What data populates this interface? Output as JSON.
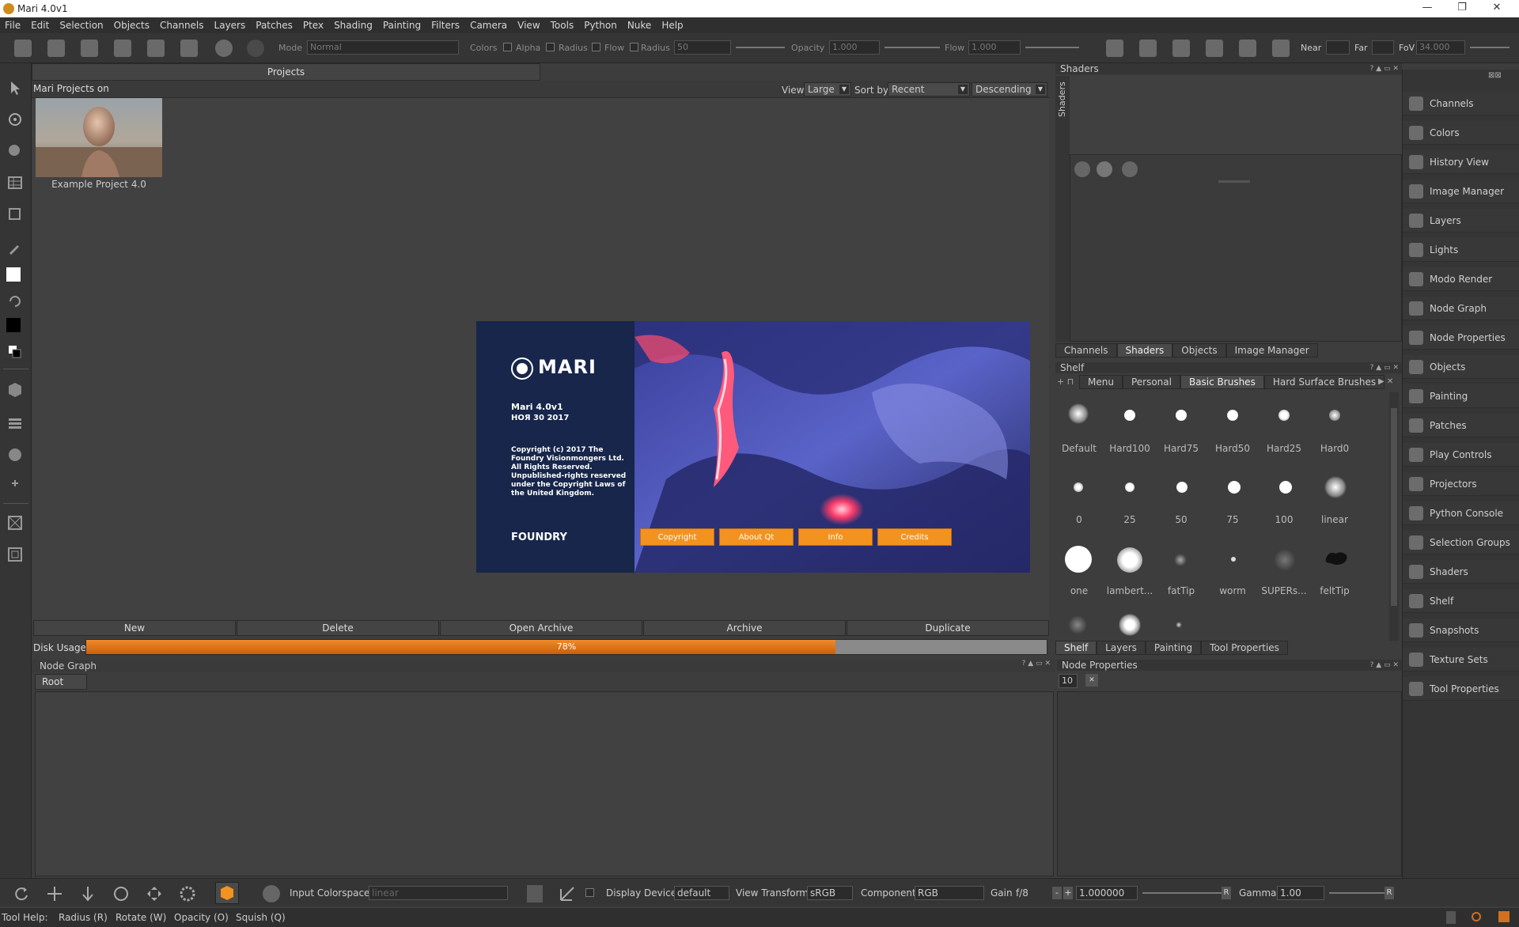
{
  "window": {
    "title": "Mari 4.0v1",
    "minimize": "—",
    "maximize": "❐",
    "close": "✕"
  },
  "menu": [
    "File",
    "Edit",
    "Selection",
    "Objects",
    "Channels",
    "Layers",
    "Patches",
    "Ptex",
    "Shading",
    "Painting",
    "Filters",
    "Camera",
    "View",
    "Tools",
    "Python",
    "Nuke",
    "Help"
  ],
  "toolbar": {
    "mode_label": "Mode",
    "mode_value": "Normal",
    "colors_label": "Colors",
    "alpha_label": "Alpha",
    "radius_label": "Radius",
    "flow_label": "Flow",
    "radius2_label": "Radius",
    "radius_value": "50",
    "opacity_label": "Opacity",
    "opacity_value": "1.000",
    "flow2_label": "Flow",
    "flow_value": "1.000",
    "near_label": "Near",
    "far_label": "Far",
    "fov_label": "FoV",
    "fov_value": "34.000"
  },
  "projects": {
    "tab": "Projects",
    "header": "Mari Projects on",
    "view_label": "View",
    "view_value": "Large",
    "sort_label": "Sort by",
    "sort_value": "Recent",
    "order_value": "Descending",
    "items": [
      {
        "name": "Example Project 4.0"
      }
    ],
    "buttons": [
      "New",
      "Delete",
      "Open Archive",
      "Archive",
      "Duplicate"
    ],
    "disk_label": "Disk Usage",
    "disk_percent_text": "78%",
    "disk_fraction": 0.78
  },
  "splash": {
    "logo": "MARI",
    "version": "Mari 4.0v1",
    "date": "НОЯ 30 2017",
    "copyright": "Copyright (c) 2017 The Foundry Visionmongers Ltd.  All Rights Reserved.  Unpublished-rights reserved under the Copyright Laws of the United Kingdom.",
    "company": "FOUNDRY",
    "buttons": [
      "Copyright",
      "About Qt",
      "Info",
      "Credits"
    ]
  },
  "node_graph": {
    "title": "Node Graph",
    "root_tab": "Root"
  },
  "shaders": {
    "title": "Shaders",
    "vertical_label": "Shaders",
    "tabs": [
      "Channels",
      "Shaders",
      "Objects",
      "Image Manager"
    ]
  },
  "shelf": {
    "title": "Shelf",
    "tabs": [
      "Menu",
      "Personal",
      "Basic Brushes",
      "Hard Surface Brushes"
    ],
    "brushes": [
      "Default",
      "Hard100",
      "Hard75",
      "Hard50",
      "Hard25",
      "Hard0",
      "0",
      "25",
      "50",
      "75",
      "100",
      "linear",
      "one",
      "lambert...",
      "fatTip",
      "worm",
      "SUPERs...",
      "feltTip"
    ],
    "bottom_tabs": [
      "Shelf",
      "Layers",
      "Painting",
      "Tool Properties"
    ]
  },
  "node_properties": {
    "title": "Node Properties",
    "count_value": "10"
  },
  "palette": [
    "Channels",
    "Colors",
    "History View",
    "Image Manager",
    "Layers",
    "Lights",
    "Modo Render",
    "Node Graph",
    "Node Properties",
    "Objects",
    "Painting",
    "Patches",
    "Play Controls",
    "Projectors",
    "Python Console",
    "Selection Groups",
    "Shaders",
    "Shelf",
    "Snapshots",
    "Texture Sets",
    "Tool Properties"
  ],
  "bottom": {
    "input_colorspace_label": "Input Colorspace",
    "input_colorspace_value": "linear",
    "display_device_label": "Display Device",
    "display_device_value": "default",
    "view_transform_label": "View Transform",
    "view_transform_value": "sRGB",
    "component_label": "Component",
    "component_value": "RGB",
    "gain_label": "Gain",
    "gain_value": "f/8",
    "gain_number": "1.000000",
    "gamma_label": "Gamma",
    "gamma_value": "1.00",
    "r_label": "R"
  },
  "status": {
    "tool_help": "Tool Help:",
    "radius": "Radius (R)",
    "rotate": "Rotate (W)",
    "opacity": "Opacity (O)",
    "squish": "Squish (Q)"
  },
  "colors": {
    "accent": "#f3931f",
    "panel": "#3d3d3d",
    "dark": "#2f2f2f"
  }
}
